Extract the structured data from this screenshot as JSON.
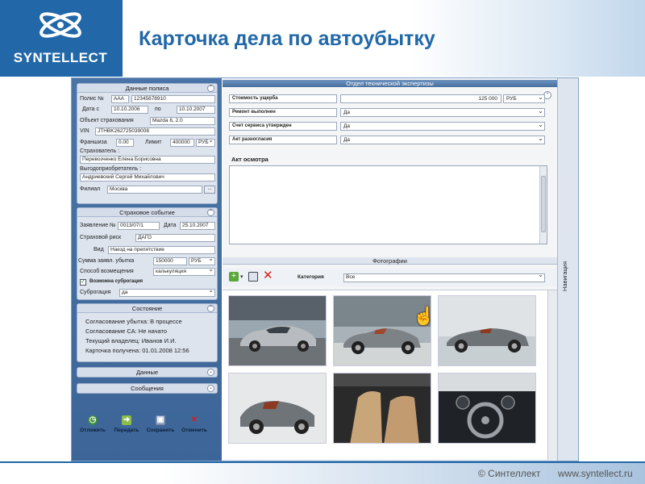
{
  "slide": {
    "title": "Карточка дела по автоубытку",
    "logo_text": "SYNTELLECT",
    "footer_copyright": "© Синтеллект",
    "footer_url": "www.syntellect.ru"
  },
  "policy": {
    "header": "Данные полиса",
    "policy_label": "Полис №",
    "policy_series": "AAA",
    "policy_number": "12345678910",
    "date_from_label": "Дата с",
    "date_from": "10.10.2006",
    "date_to_label": "по",
    "date_to": "10.10.2007",
    "object_label": "Объект страхования",
    "object_value": "Mazda 6, 2.0",
    "vin_label": "VIN",
    "vin_value": "JTHBK262725039008",
    "franchise_label": "Франшиза",
    "franchise_value": "0.00",
    "limit_label": "Лимит",
    "limit_value": "400000",
    "limit_currency": "РУБ",
    "insurer_label": "Страхователь :",
    "insurer_value": "Перевозченко Елена Борисовна",
    "beneficiary_label": "Выгодоприобретатель :",
    "beneficiary_value": "Андриевский Сергей Михайлович",
    "branch_label": "Филиал",
    "branch_value": "Москва",
    "branch_button": "..."
  },
  "event": {
    "header": "Страховое событие",
    "claim_label": "Заявление №",
    "claim_value": "0013/07/1",
    "date_label": "Дата",
    "date_value": "25.10.2007",
    "risk_label": "Страховой риск",
    "risk_value": "ДАГО",
    "kind_label": "Вид",
    "kind_value": "Наезд на препятствие",
    "amount_label": "Сумма заявл. убытка",
    "amount_value": "150000",
    "amount_currency": "РУБ",
    "method_label": "Способ возмещения",
    "method_value": "калькуляция",
    "subrogation_check_label": "Возможна суброгация",
    "subrogation_label": "Суброгация",
    "subrogation_value": "да"
  },
  "status": {
    "header": "Состояние",
    "lines": [
      "Согласование убытка: В процессе",
      "Согласование СА: Не начато",
      "Текущий владелец: Иванов И.И.",
      "Карточка получена: 01.01.2008 12:56"
    ]
  },
  "data_section": {
    "header": "Данные"
  },
  "messages_section": {
    "header": "Сообщения"
  },
  "actions": {
    "reject": "Отложить",
    "forward": "Передать",
    "save": "Сохранить",
    "cancel": "Отменить"
  },
  "expertise": {
    "header": "Отдел технической экспертизы",
    "fields": [
      {
        "label": "Стоимость ущерба",
        "value": "125 000",
        "currency": "РУБ"
      },
      {
        "label": "Ремонт выполнен",
        "value": "Да"
      },
      {
        "label": "Счет сервиса утвержден",
        "value": "Да"
      },
      {
        "label": "Акт разногласия",
        "value": "Да"
      }
    ],
    "inspection_label": "Акт осмотра"
  },
  "photos": {
    "header": "Фотографии",
    "category_label": "Категория",
    "category_value": "Все"
  },
  "navigation_label": "Навигация",
  "icons": {
    "add": "add-photo-icon",
    "save": "save-icon",
    "delete": "delete-icon",
    "cursor": "hand-cursor-icon"
  },
  "colors": {
    "brand_blue": "#2268a8",
    "panel_blue": "#4a74a8"
  }
}
